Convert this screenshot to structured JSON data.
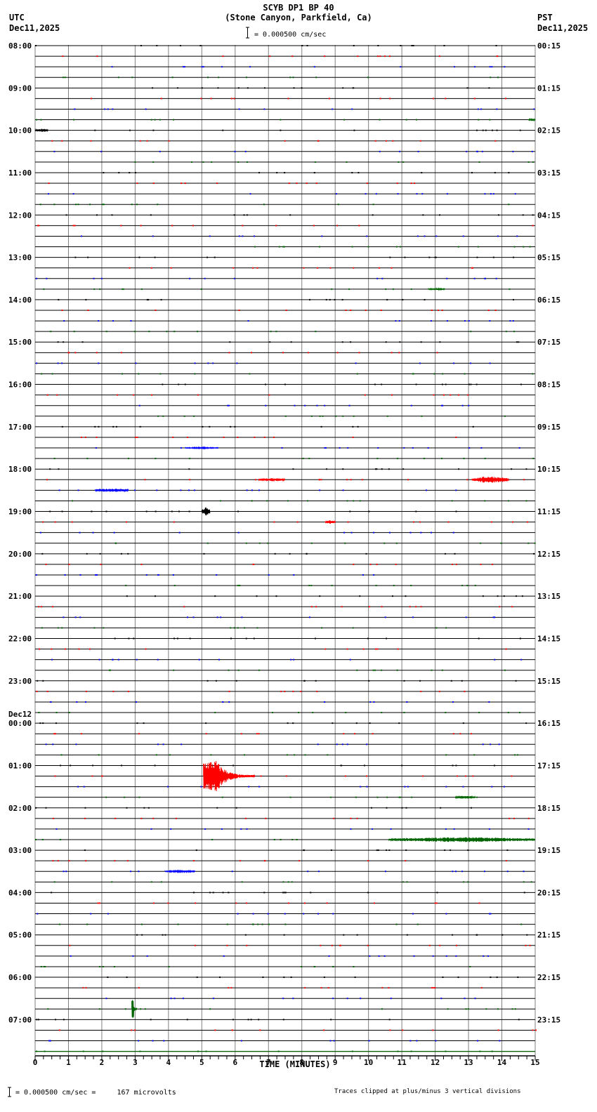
{
  "header": {
    "title": "SCYB DP1 BP 40",
    "subtitle": "(Stone Canyon, Parkfield, Ca)",
    "left_tz": "UTC",
    "left_date": "Dec11,2025",
    "right_tz": "PST",
    "right_date": "Dec11,2025",
    "scale_text": "= 0.000500 cm/sec"
  },
  "footer": {
    "scale_text": "= 0.000500 cm/sec =     167 microvolts",
    "clip_note": "Traces clipped at plus/minus 3 vertical divisions"
  },
  "chart_data": {
    "type": "line",
    "title": "SCYB DP1 BP 40",
    "xlabel": "TIME (MINUTES)",
    "xlim": [
      0,
      15
    ],
    "x_ticks": [
      "0",
      "1",
      "2",
      "3",
      "4",
      "5",
      "6",
      "7",
      "8",
      "9",
      "10",
      "11",
      "12",
      "13",
      "14",
      "15"
    ],
    "rows": 96,
    "trace_colors": [
      "#000000",
      "#ff0000",
      "#0000ff",
      "#006400"
    ],
    "left_labels": [
      "08:00",
      "09:00",
      "10:00",
      "11:00",
      "12:00",
      "13:00",
      "14:00",
      "15:00",
      "16:00",
      "17:00",
      "18:00",
      "19:00",
      "20:00",
      "21:00",
      "22:00",
      "23:00",
      "00:00",
      "01:00",
      "02:00",
      "03:00",
      "04:00",
      "05:00",
      "06:00",
      "07:00"
    ],
    "left_date_change": {
      "label": "Dec12",
      "hour_index": 16
    },
    "right_labels": [
      "00:15",
      "01:15",
      "02:15",
      "03:15",
      "04:15",
      "05:15",
      "06:15",
      "07:15",
      "08:15",
      "09:15",
      "10:15",
      "11:15",
      "12:15",
      "13:15",
      "14:15",
      "15:15",
      "16:15",
      "17:15",
      "18:15",
      "19:15",
      "20:15",
      "21:15",
      "22:15",
      "23:15"
    ],
    "events": [
      {
        "row": 7,
        "start": 14.8,
        "end": 15.0,
        "amp": 0.3
      },
      {
        "row": 8,
        "start": 0.0,
        "end": 0.4,
        "amp": 0.3
      },
      {
        "row": 23,
        "start": 11.8,
        "end": 12.3,
        "amp": 0.15
      },
      {
        "row": 38,
        "start": 4.5,
        "end": 5.5,
        "amp": 0.15
      },
      {
        "row": 41,
        "start": 6.7,
        "end": 7.5,
        "amp": 0.3
      },
      {
        "row": 41,
        "start": 13.1,
        "end": 14.2,
        "amp": 0.7
      },
      {
        "row": 42,
        "start": 1.8,
        "end": 2.8,
        "amp": 0.35
      },
      {
        "row": 44,
        "start": 5.0,
        "end": 5.25,
        "amp": 0.8
      },
      {
        "row": 45,
        "start": 8.7,
        "end": 9.0,
        "amp": 0.35
      },
      {
        "row": 69,
        "start": 5.05,
        "end": 6.6,
        "amp": 3.0
      },
      {
        "row": 71,
        "start": 12.6,
        "end": 13.2,
        "amp": 0.3
      },
      {
        "row": 75,
        "start": 10.6,
        "end": 15.0,
        "amp": 0.5
      },
      {
        "row": 78,
        "start": 3.9,
        "end": 4.8,
        "amp": 0.2
      },
      {
        "row": 91,
        "start": 2.9,
        "end": 3.05,
        "amp": 2.0
      }
    ]
  }
}
